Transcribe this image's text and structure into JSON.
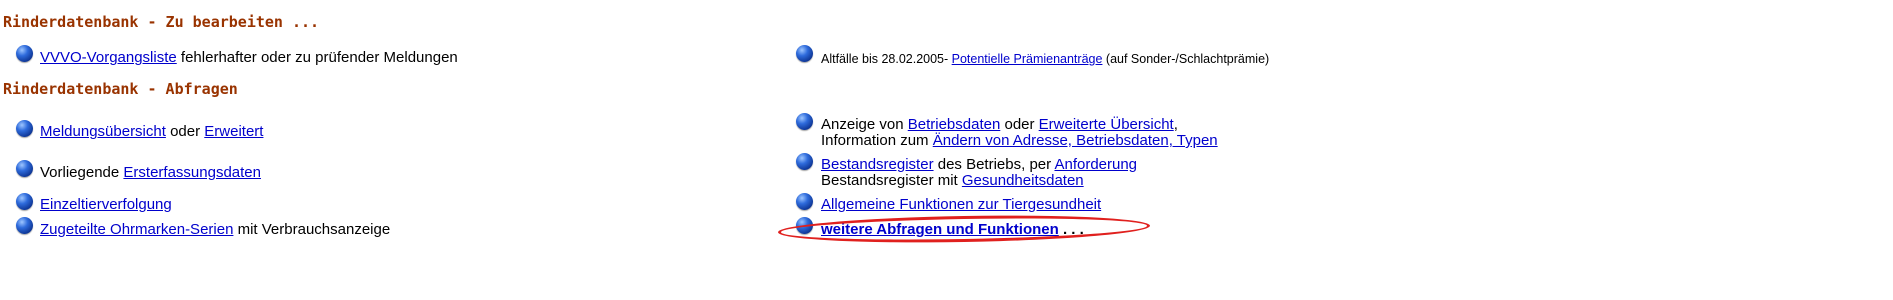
{
  "headings": {
    "to_edit": "Rinderdatenbank - Zu bearbeiten ...",
    "queries": "Rinderdatenbank - Abfragen"
  },
  "left": {
    "vvvo_link": "VVVO-Vorgangsliste",
    "vvvo_text": " fehlerhafter oder zu prüfender Meldungen",
    "meldung_link": "Meldungsübersicht",
    "meldung_text": " oder ",
    "erweitert_link": "Erweitert",
    "vorliegende_text": "Vorliegende ",
    "ersterfassung_link": "Ersterfassungsdaten",
    "einzeltier_link": "Einzeltierverfolgung",
    "ohrmarken_link": "Zugeteilte Ohrmarken-Serien",
    "ohrmarken_text": " mit Verbrauchsanzeige"
  },
  "right": {
    "altfaelle_text": "Altfälle bis 28.02.2005- ",
    "praemien_link": "Potentielle Prämienanträge",
    "praemien_suffix": " (auf Sonder-/Schlachtprämie)",
    "anzeige_text": "Anzeige von ",
    "betriebsdaten_link": "Betriebsdaten",
    "oder_text": " oder ",
    "erw_uebersicht_link": "Erweiterte Übersicht",
    "comma_text": ",",
    "info_text": "Information zum ",
    "aendern_link": "Ändern von Adresse, Betriebsdaten, Typen",
    "bestandsregister_link": "Bestandsregister",
    "betrieb_text": " des Betriebs, per ",
    "anforderung_link": "Anforderung",
    "bestandsregister_mit_text": "Bestandsregister mit ",
    "gesundheit_link": "Gesundheitsdaten",
    "allgemeine_link": "Allgemeine Funktionen zur Tiergesundheit",
    "weitere_link": "weitere Abfragen und Funktionen",
    "weitere_suffix": " . . ."
  },
  "colors": {
    "heading": "#993300",
    "link": "#0000cc",
    "highlight_ellipse": "#e0201e"
  }
}
